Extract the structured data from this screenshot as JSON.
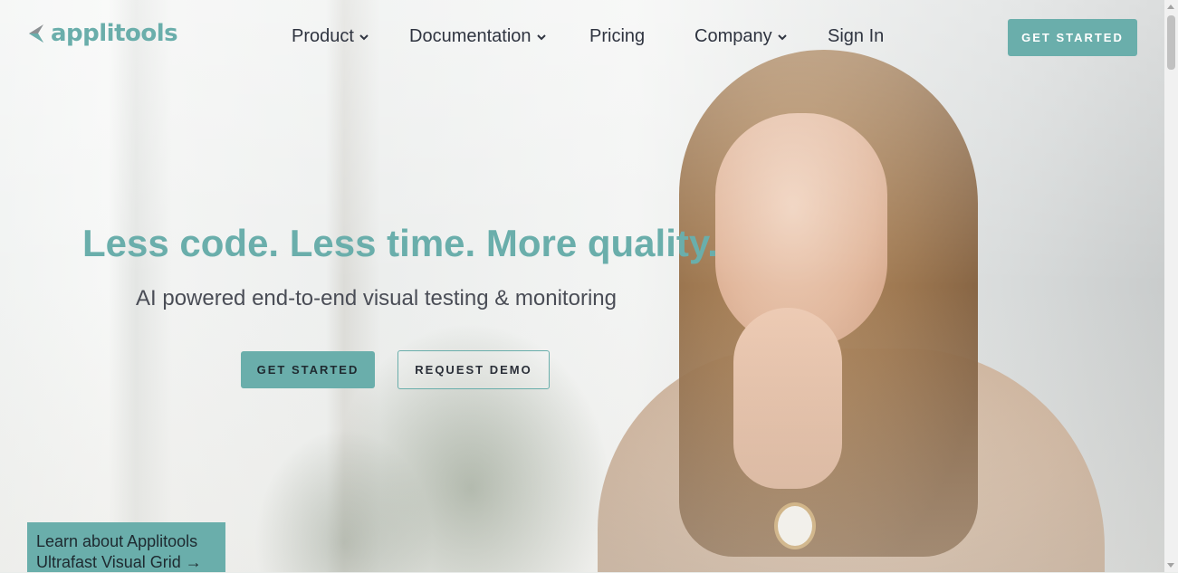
{
  "brand": {
    "name": "applitools",
    "color": "#6aaeab",
    "logo_icon": "applitools-logo-icon"
  },
  "nav": {
    "items": [
      {
        "label": "Product",
        "has_dropdown": true
      },
      {
        "label": "Documentation",
        "has_dropdown": true
      },
      {
        "label": "Pricing",
        "has_dropdown": false
      },
      {
        "label": "Company",
        "has_dropdown": true
      },
      {
        "label": "Sign In",
        "has_dropdown": false
      }
    ],
    "cta_label": "GET STARTED"
  },
  "hero": {
    "headline": "Less code. Less time. More quality.",
    "subheadline": "AI powered end-to-end visual testing & monitoring",
    "primary_button": "GET STARTED",
    "secondary_button": "REQUEST DEMO"
  },
  "promo": {
    "line1": "Learn about Applitools",
    "line2": "Ultrafast Visual Grid →"
  },
  "colors": {
    "accent": "#6aaeab",
    "nav_text": "#2f3440",
    "subhead": "#4a4d56"
  }
}
